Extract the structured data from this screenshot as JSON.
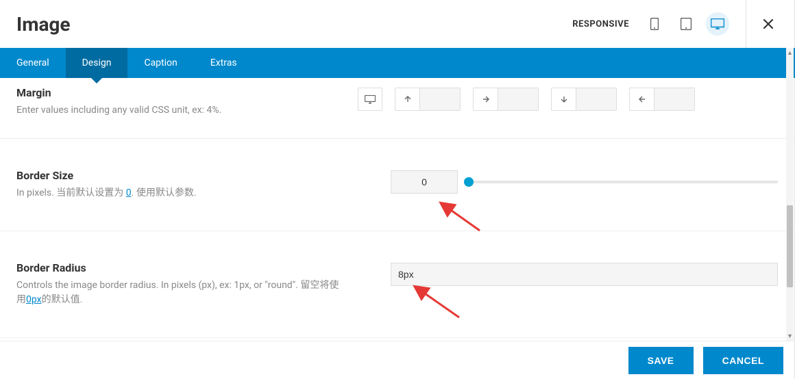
{
  "header": {
    "title": "Image",
    "responsive_label": "RESPONSIVE"
  },
  "tabs": [
    {
      "label": "General",
      "active": false
    },
    {
      "label": "Design",
      "active": true
    },
    {
      "label": "Caption",
      "active": false
    },
    {
      "label": "Extras",
      "active": false
    }
  ],
  "margin": {
    "title": "Margin",
    "desc": "Enter values including any valid CSS unit, ex: 4%.",
    "top": "",
    "right": "",
    "bottom": "",
    "left": ""
  },
  "border_size": {
    "title": "Border Size",
    "desc_prefix": "In pixels. 当前默认设置为 ",
    "default_link": "0",
    "desc_suffix": ". 使用默认参数.",
    "value": "0"
  },
  "border_radius": {
    "title": "Border Radius",
    "desc_prefix": "Controls the image border radius. In pixels (px), ex: 1px, or \"round\". 留空将使用",
    "default_link": "0px",
    "desc_suffix": "的默认值.",
    "value": "8px"
  },
  "footer": {
    "save": "SAVE",
    "cancel": "CANCEL"
  }
}
